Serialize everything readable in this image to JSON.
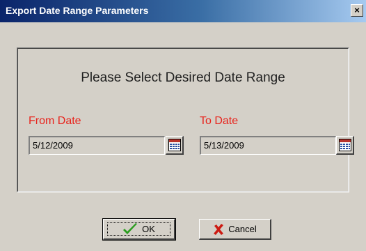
{
  "window": {
    "title": "Export Date Range Parameters",
    "close_label": "×"
  },
  "form": {
    "prompt": "Please Select Desired Date Range",
    "from": {
      "label": "From Date",
      "value": "5/12/2009"
    },
    "to": {
      "label": "To Date",
      "value": "5/13/2009"
    }
  },
  "buttons": {
    "ok_label": "OK",
    "cancel_label": "Cancel"
  },
  "colors": {
    "label_red": "#e8231c",
    "ok_check": "#2a9d1f",
    "cancel_x": "#cc1a12"
  },
  "icons": {
    "calendar": "calendar-icon",
    "ok": "checkmark-icon",
    "cancel": "x-mark-icon"
  }
}
